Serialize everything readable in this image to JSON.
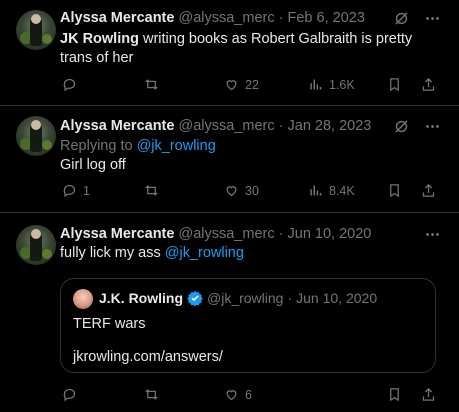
{
  "tweets": [
    {
      "name": "Alyssa Mercante",
      "handle": "@alyssa_merc",
      "sep": "·",
      "date": "Feb 6, 2023",
      "text_bold": "JK Rowling",
      "text_rest": " writing books as Robert Galbraith is pretty trans of her",
      "actions": {
        "reply": "",
        "retweet": "",
        "like": "22",
        "views": "1.6K"
      }
    },
    {
      "name": "Alyssa Mercante",
      "handle": "@alyssa_merc",
      "sep": "·",
      "date": "Jan 28, 2023",
      "replying_prefix": "Replying to ",
      "replying_to": "@jk_rowling",
      "text": "Girl log off",
      "actions": {
        "reply": "1",
        "retweet": "",
        "like": "30",
        "views": "8.4K"
      }
    },
    {
      "name": "Alyssa Mercante",
      "handle": "@alyssa_merc",
      "sep": "·",
      "date": "Jun 10, 2020",
      "text": "fully lick my ass ",
      "mention": "@jk_rowling",
      "quote": {
        "name": "J.K. Rowling",
        "handle": "@jk_rowling",
        "sep": "·",
        "date": "Jun 10, 2020",
        "line1": "TERF wars",
        "line2": "jkrowling.com/answers/"
      },
      "actions": {
        "reply": "",
        "retweet": "",
        "like": "6"
      }
    }
  ],
  "icons": [
    "grok-icon",
    "more-icon",
    "reply-icon",
    "retweet-icon",
    "like-icon",
    "views-icon",
    "bookmark-icon",
    "share-icon",
    "verified-badge-icon"
  ],
  "colors": {
    "background": "#000000",
    "text": "#e7e9ea",
    "muted": "#71767b",
    "link": "#1d9bf0",
    "border": "#2f3336"
  }
}
